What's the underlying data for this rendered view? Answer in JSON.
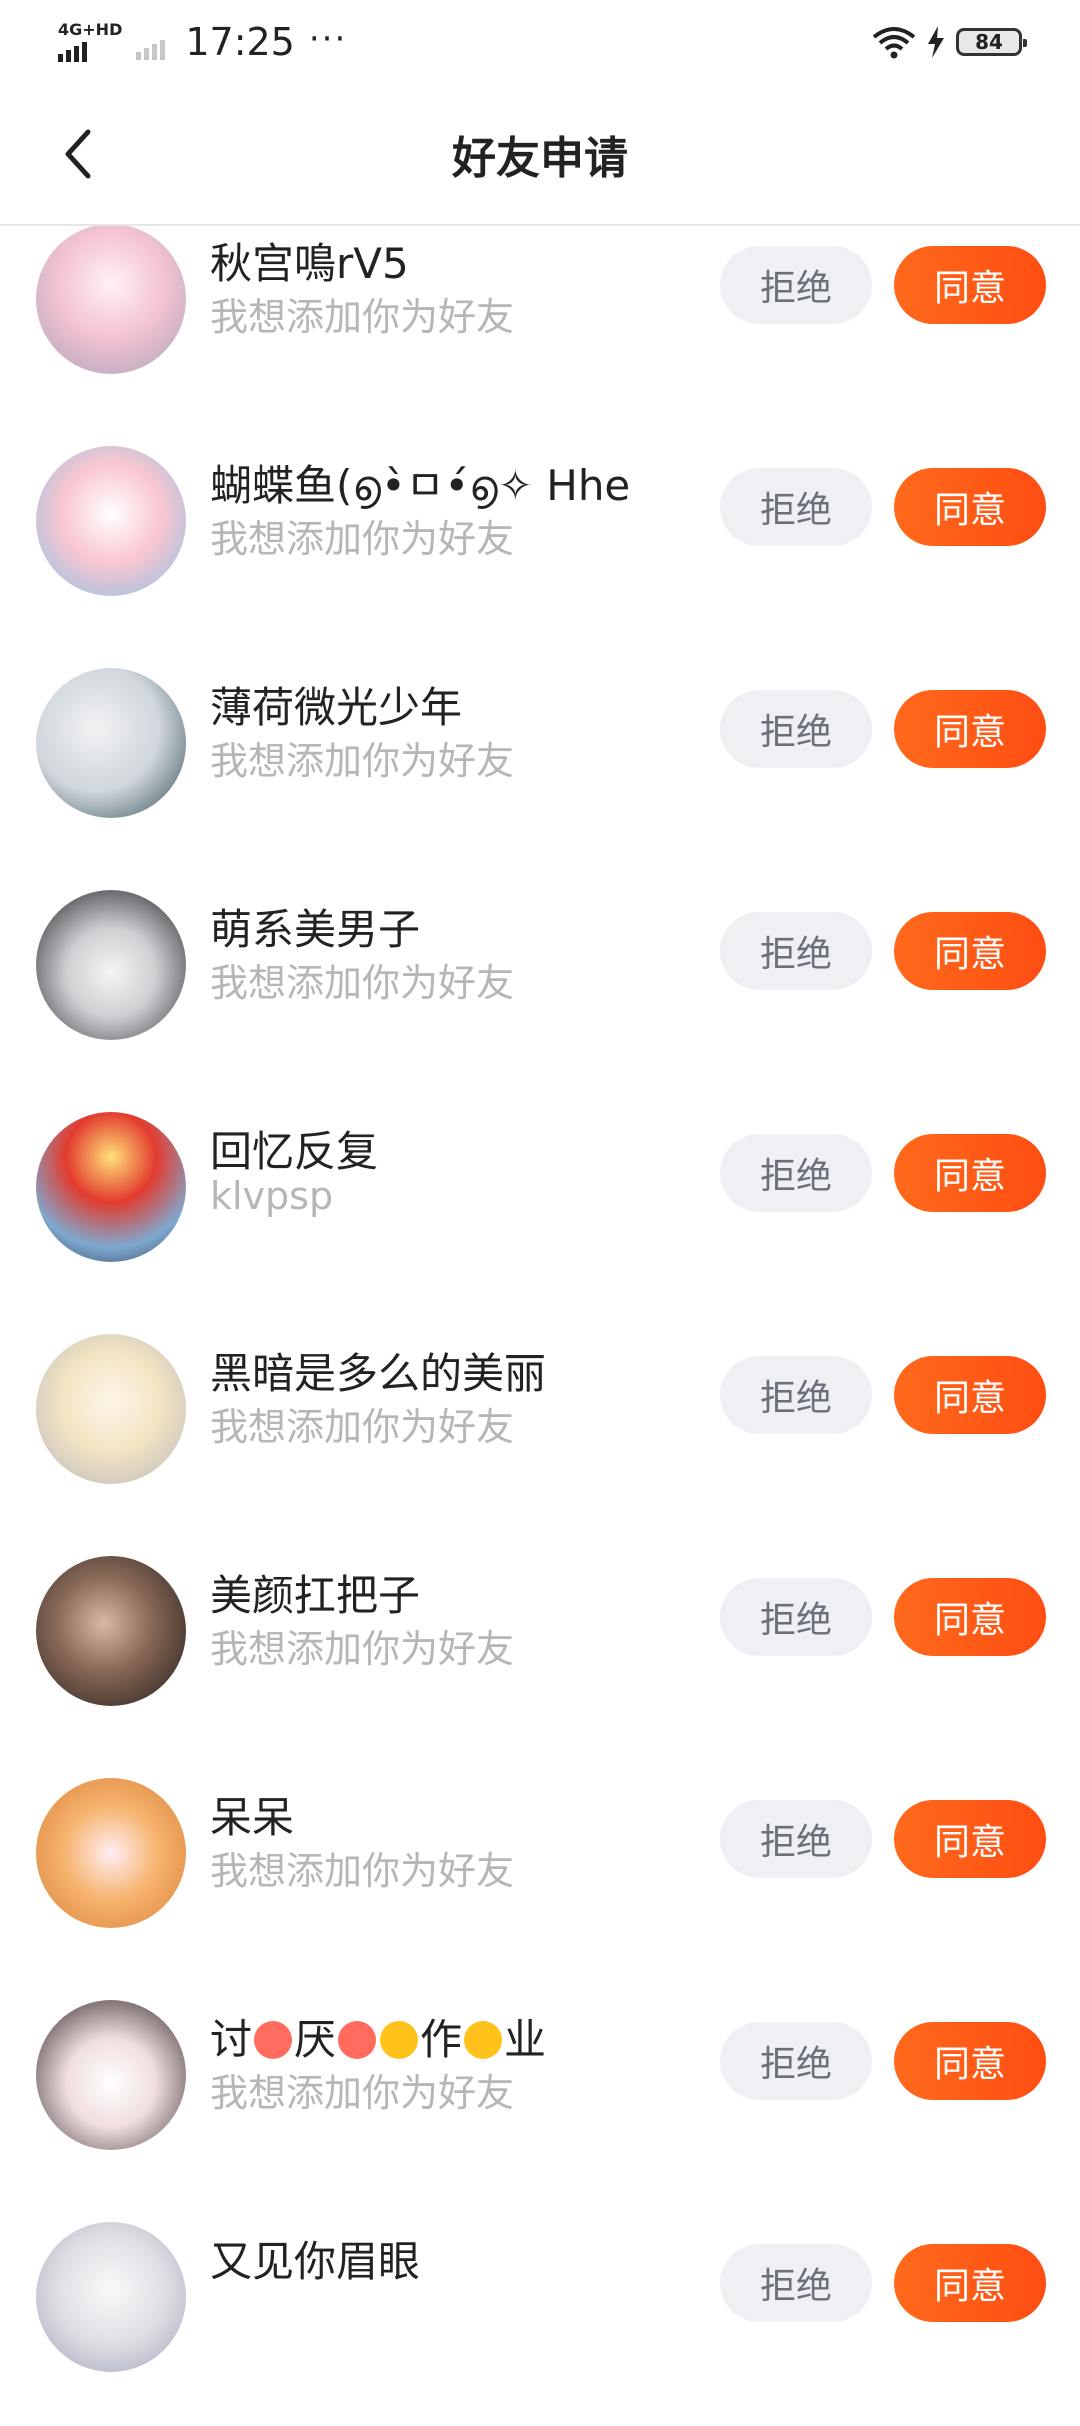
{
  "status_bar": {
    "network": "4G+HD",
    "time": "17:25",
    "dots": "···",
    "battery": "84"
  },
  "header": {
    "title": "好友申请"
  },
  "buttons": {
    "reject": "拒绝",
    "accept": "同意"
  },
  "requests": [
    {
      "name": "秋宫鳴rV5",
      "message": "我想添加你为好友",
      "avatar_color": "#f3c5d1"
    },
    {
      "name": "蝴蝶鱼(൭•̀ㅁ•́൭✧ Hhe",
      "message": "我想添加你为好友",
      "avatar_color": "#f7b7c2"
    },
    {
      "name": "薄荷微光少年",
      "message": "我想添加你为好友",
      "avatar_color": "#d9dde3"
    },
    {
      "name": "萌系美男子",
      "message": "我想添加你为好友",
      "avatar_color": "#c8c8cc"
    },
    {
      "name": "回忆反复",
      "message": "klvpsp",
      "avatar_color": "#8fb3d6"
    },
    {
      "name": "黑暗是多么的美丽",
      "message": "我想添加你为好友",
      "avatar_color": "#c9c2c6"
    },
    {
      "name": "美颜扛把子",
      "message": "我想添加你为好友",
      "avatar_color": "#5a4a43"
    },
    {
      "name": "呆呆",
      "message": "我想添加你为好友",
      "avatar_color": "#f2a86a"
    },
    {
      "name_parts": [
        "讨",
        "厌",
        "作",
        "业"
      ],
      "message": "我想添加你为好友",
      "avatar_color": "#4a3a3f"
    },
    {
      "name": "又见你眉眼",
      "message": "",
      "avatar_color": "#e3e0e6"
    }
  ]
}
